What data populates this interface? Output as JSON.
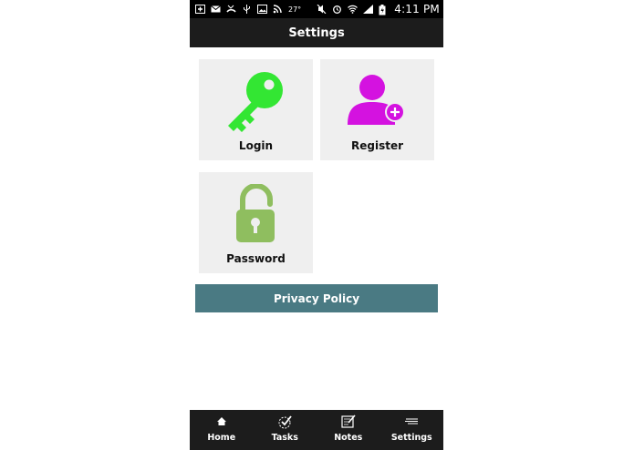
{
  "status_bar": {
    "temperature": "27°",
    "time": "4:11 PM",
    "left_icons": [
      "add-box-icon",
      "mail-icon",
      "missed-call-icon",
      "usb-icon",
      "image-icon",
      "rss-icon"
    ],
    "right_icons": [
      "mute-icon",
      "alarm-icon",
      "wifi-icon",
      "signal-icon",
      "battery-icon"
    ]
  },
  "app_bar": {
    "title": "Settings"
  },
  "tiles": [
    {
      "label": "Login",
      "icon": "key-icon",
      "color": "#33e633"
    },
    {
      "label": "Register",
      "icon": "add-user-icon",
      "color": "#d412e0"
    },
    {
      "label": "Password",
      "icon": "unlock-icon",
      "color": "#8fbe5f"
    }
  ],
  "privacy_button": {
    "label": "Privacy Policy",
    "color": "#4a7a83"
  },
  "bottom_nav": {
    "items": [
      {
        "label": "Home",
        "icon": "home-icon"
      },
      {
        "label": "Tasks",
        "icon": "tasks-icon"
      },
      {
        "label": "Notes",
        "icon": "notes-icon"
      },
      {
        "label": "Settings",
        "icon": "settings-icon"
      }
    ]
  }
}
